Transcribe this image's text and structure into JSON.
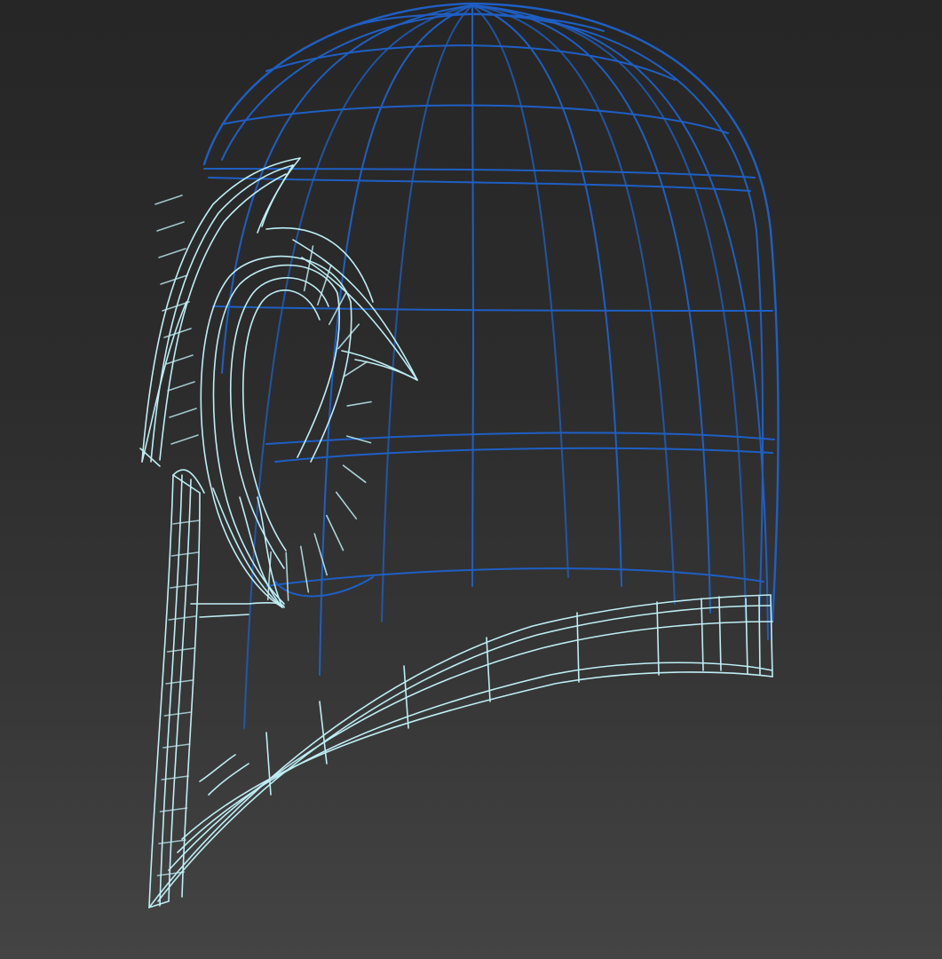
{
  "viewport": {
    "render_mode": "wireframe",
    "object": "helmet",
    "colors": {
      "background_top": "#262626",
      "background_bottom": "#444444",
      "shell_wire": "#1f5fc4",
      "shell_wire_dim": "#1a4a9a",
      "trim_wire": "#bfeef5"
    }
  }
}
